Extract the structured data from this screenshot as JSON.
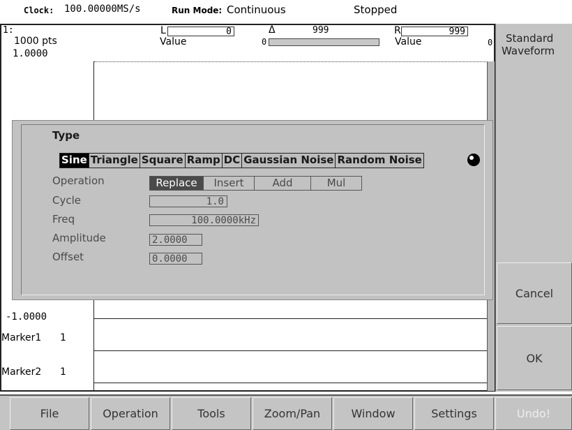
{
  "statusbar": {
    "clock_label": "Clock:",
    "clock_value": "100.00000MS/s",
    "runmode_label": "Run Mode:",
    "runmode_value": "Continuous",
    "state": "Stopped"
  },
  "editor": {
    "channel": "1:",
    "points": "1000 pts",
    "left_cursor_label": "L",
    "left_cursor_value": "0",
    "left_value_label": "Value",
    "delta_symbol": "Δ",
    "delta_value": "999",
    "scroll_start": "0",
    "right_cursor_label": "R",
    "right_cursor_value": "999",
    "right_value_label": "Value",
    "right_value": "0",
    "y_max": "1.0000",
    "y_min": "-1.0000",
    "marker1_label": "Marker1",
    "marker1_value": "1",
    "marker2_label": "Marker2",
    "marker2_value": "1"
  },
  "sidepanel": {
    "title_line1": "Standard",
    "title_line2": "Waveform",
    "cancel": "Cancel",
    "ok": "OK"
  },
  "dialog": {
    "type_label": "Type",
    "types": [
      "Sine",
      "Triangle",
      "Square",
      "Ramp",
      "DC",
      "Gaussian Noise",
      "Random Noise"
    ],
    "selected_type": "Sine",
    "operation_label": "Operation",
    "operations": [
      "Replace",
      "Insert",
      "Add",
      "Mul"
    ],
    "selected_operation": "Replace",
    "cycle_label": "Cycle",
    "cycle_value": "1.0",
    "freq_label": "Freq",
    "freq_value": "100.0000kHz",
    "amplitude_label": "Amplitude",
    "amplitude_value": "2.0000",
    "offset_label": "Offset",
    "offset_value": "0.0000",
    "knob_icon": "knob-icon"
  },
  "menubar": {
    "items": [
      "File",
      "Operation",
      "Tools",
      "Zoom/Pan",
      "Window",
      "Settings",
      "Undo!"
    ],
    "disabled": [
      "Undo!"
    ]
  }
}
